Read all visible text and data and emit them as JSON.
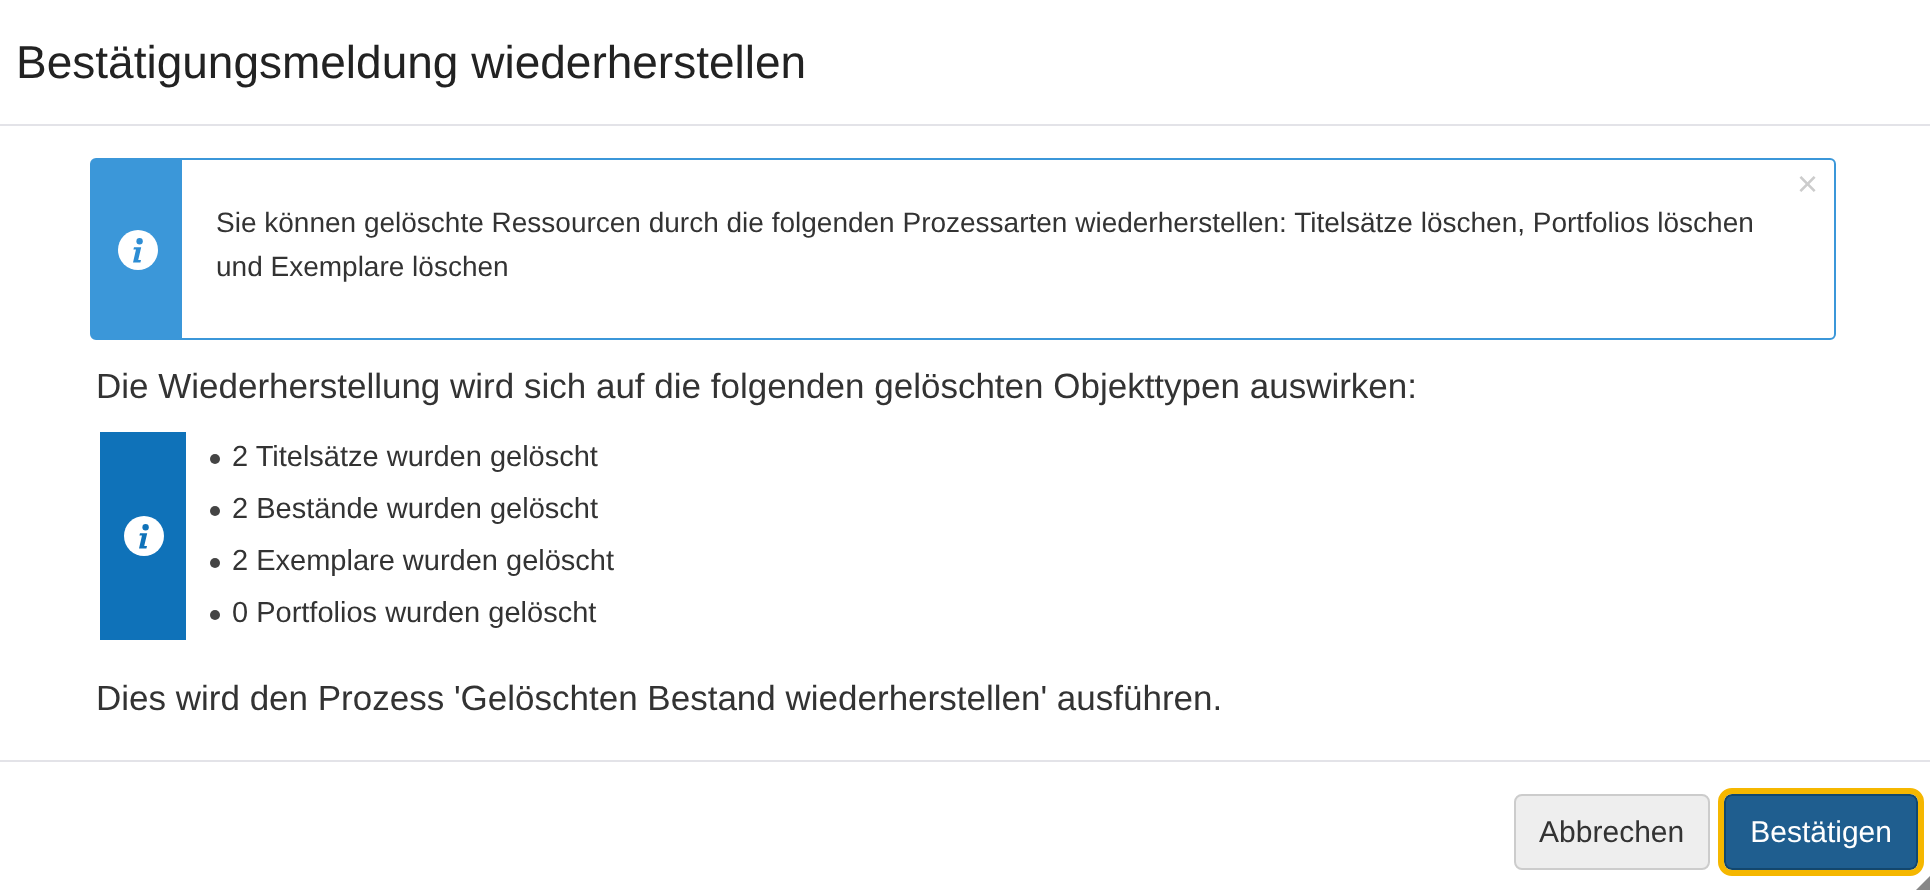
{
  "dialog": {
    "title": "Bestätigungsmeldung wiederherstellen"
  },
  "alert": {
    "message": "Sie können gelöschte Ressourcen durch die folgenden Prozessarten wiederherstellen: Titelsätze löschen, Portfolios löschen und Exemplare löschen",
    "close": "×"
  },
  "heading": "Die Wiederherstellung wird sich auf die folgenden gelöschten Objekttypen auswirken:",
  "affected_items": [
    "2 Titelsätze wurden gelöscht",
    "2 Bestände wurden gelöscht",
    "2 Exemplare wurden gelöscht",
    "0 Portfolios wurden gelöscht"
  ],
  "process_note": "Dies wird den Prozess 'Gelöschten Bestand wiederherstellen' ausführen.",
  "buttons": [
    {
      "label": "Abbrechen",
      "kind": "secondary",
      "focused": false
    },
    {
      "label": "Bestätigen",
      "kind": "primary",
      "focused": true
    }
  ]
}
